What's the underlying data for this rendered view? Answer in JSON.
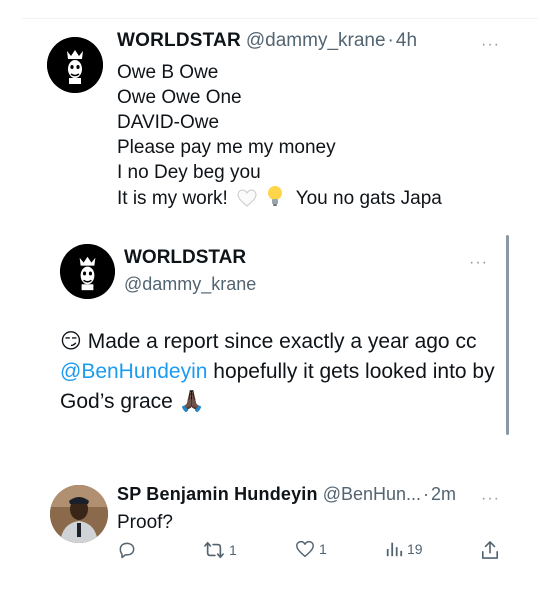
{
  "tweet1": {
    "name": "WORLDSTAR",
    "handle": "@dammy_krane",
    "dot": "·",
    "time": "4h",
    "more": "···",
    "lines": [
      "Owe B Owe",
      "Owe Owe One",
      "DAVID-Owe",
      "Please pay me my money",
      "I no Dey beg you"
    ],
    "last_line_a": "It is my work!",
    "last_line_b": "You no gats Japa"
  },
  "quoted": {
    "name": "WORLDSTAR",
    "handle": "@dammy_krane",
    "more": "···",
    "emoji": "😏",
    "text_a": "Made a report since exactly a year ago cc",
    "mention": "@BenHundeyin",
    "text_b": "hopefully it gets looked into by God’s grace",
    "pray_emoji": "🙏🏿"
  },
  "reply": {
    "name": "SP Benjamin Hundeyin",
    "handle": "@BenHun...",
    "dot": "·",
    "time": "2m",
    "more": "···",
    "text": "Proof?",
    "retweets": "1",
    "likes": "1",
    "views": "19"
  },
  "icons": [
    "reply-icon",
    "retweet-icon",
    "like-icon",
    "views-icon",
    "share-icon"
  ],
  "colors": {
    "accent": "#1d9bf0",
    "muted": "#536471",
    "text": "#0f1419"
  }
}
